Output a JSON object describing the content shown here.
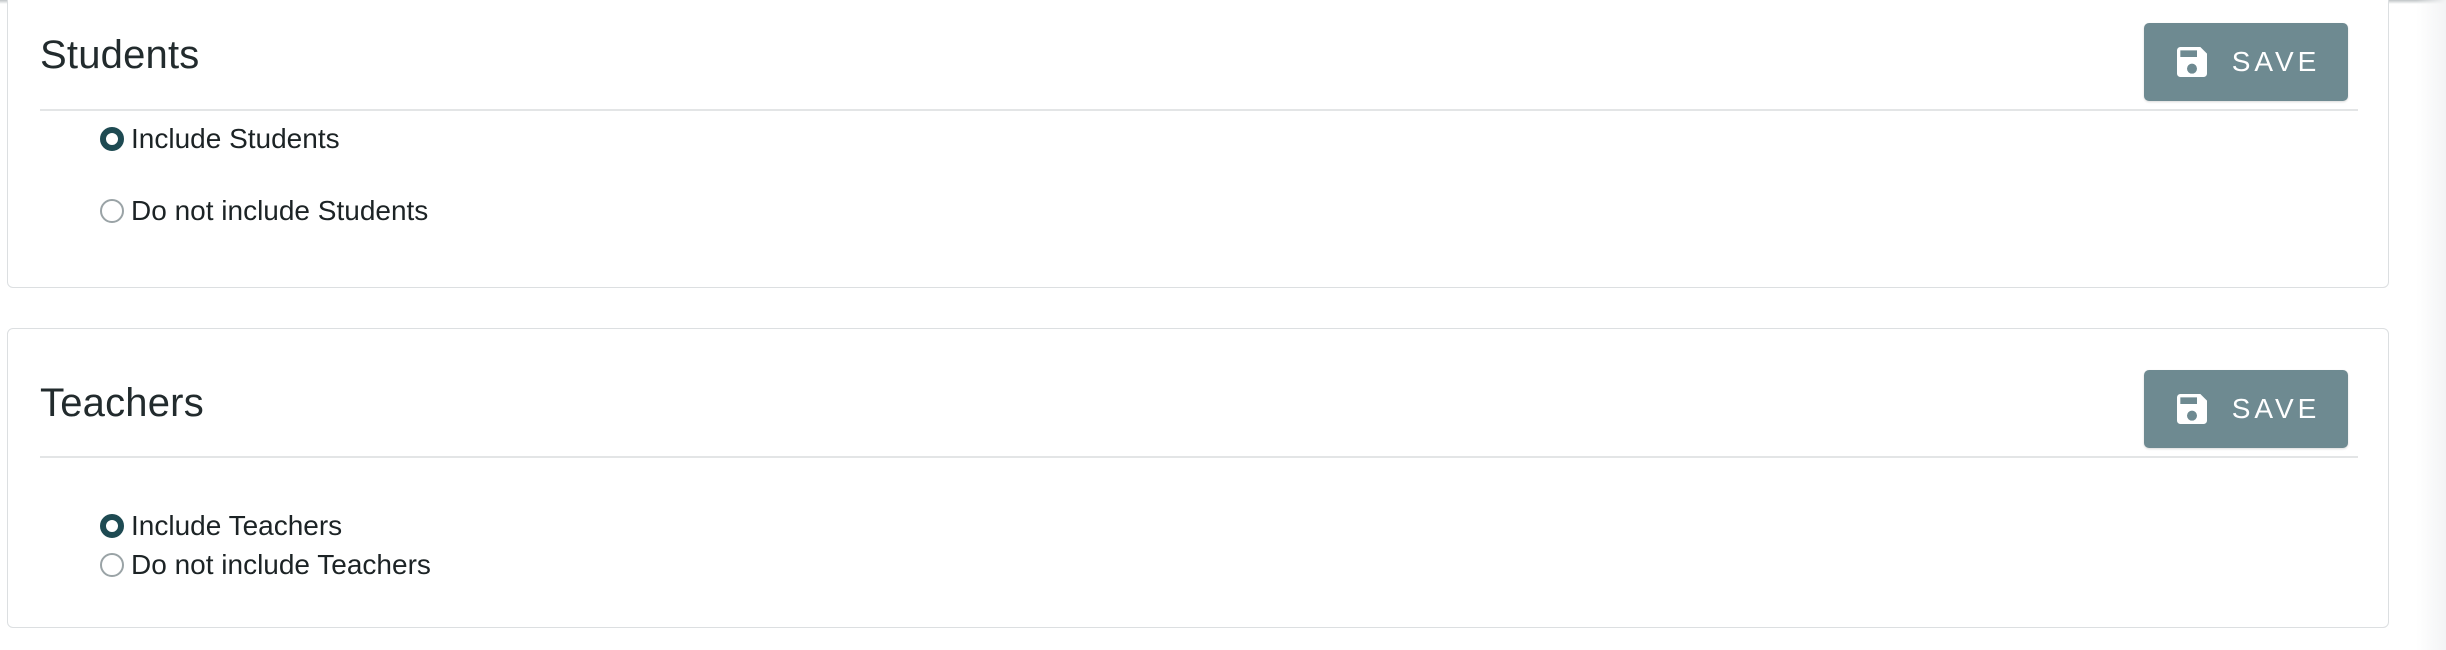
{
  "students": {
    "title": "Students",
    "save_label": "SAVE",
    "options": [
      {
        "label": "Include Students",
        "checked": true
      },
      {
        "label": "Do not include Students",
        "checked": false
      }
    ]
  },
  "teachers": {
    "title": "Teachers",
    "save_label": "SAVE",
    "options": [
      {
        "label": "Include Teachers",
        "checked": true
      },
      {
        "label": "Do not include Teachers",
        "checked": false
      }
    ]
  },
  "icons": {
    "save": "floppy-disk-icon"
  },
  "colors": {
    "button": "#6e8a91",
    "radio_selected": "#1e4a52"
  }
}
